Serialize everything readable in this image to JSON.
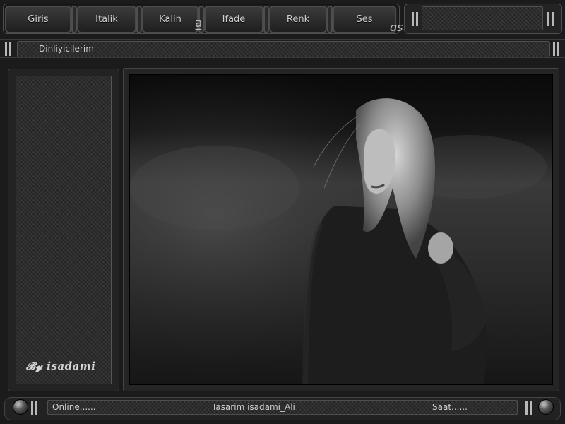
{
  "top_menu": {
    "items": [
      "Giris",
      "Italik",
      "Kalin",
      "Ifade",
      "Renk",
      "Ses"
    ]
  },
  "listeners": {
    "title": "Dinliyicilerim"
  },
  "status_bar": {
    "online": "Online......",
    "credit": "Tasarim  isadami_Ali",
    "time": "Saat......"
  }
}
